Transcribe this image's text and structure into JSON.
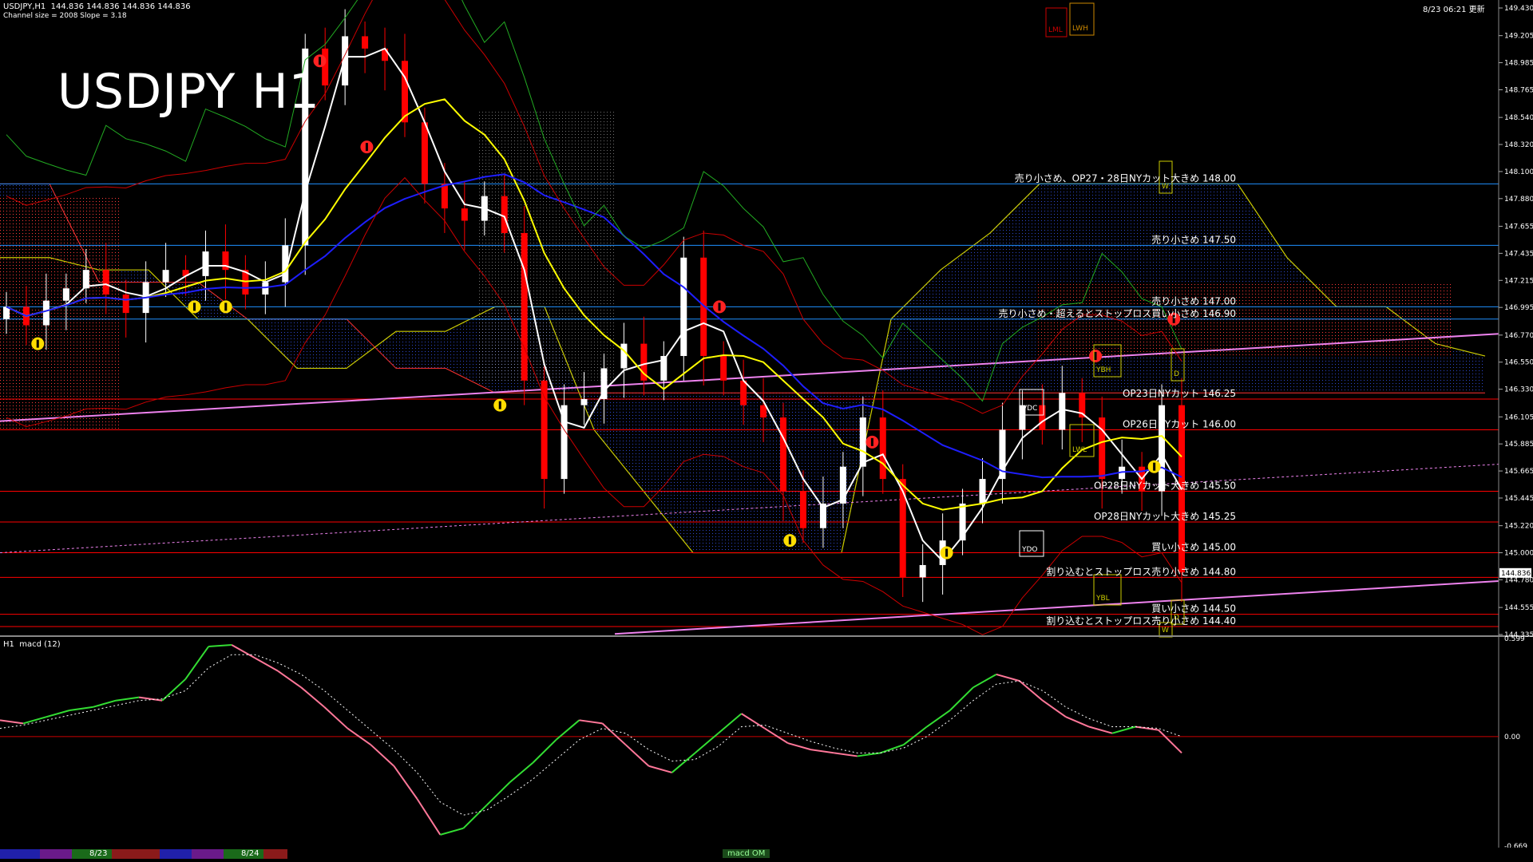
{
  "header": {
    "symbol_line": "USDJPY,H1  144.836 144.836 144.836 144.836",
    "channel_line": "Channel size = 2008 Slope = 3.18",
    "datetime": "8/23 06:21 更新",
    "big_title": "USDJPY H1",
    "macd_label": "H1  macd (12)"
  },
  "bottom": {
    "date1": "8/23",
    "date2": "8/24",
    "tab_label": "macd OM"
  },
  "colors": {
    "bull_candle": "#ffffff",
    "bear_candle": "#ff0000",
    "ma_white": "#ffffff",
    "ma_yellow": "#ffff00",
    "ma_blue": "#1e1eff",
    "level_line": "#ff0000",
    "blue_level": "#1e90ff",
    "channel": "#ee82ee",
    "macd_up": "#33dd33",
    "macd_down": "#ff7799"
  },
  "chart_data": [
    {
      "type": "candlestick",
      "title": "USDJPY H1",
      "y_ticks": [
        "149.430",
        "149.205",
        "148.985",
        "148.765",
        "148.540",
        "148.320",
        "148.100",
        "147.880",
        "147.655",
        "147.435",
        "147.215",
        "146.995",
        "146.770",
        "146.550",
        "146.330",
        "146.105",
        "145.885",
        "145.665",
        "145.445",
        "145.220",
        "145.000",
        "144.780",
        "144.555",
        "144.335"
      ],
      "ylim": [
        144.335,
        149.43
      ],
      "current_price": "144.836",
      "levels": [
        {
          "label": "売り小さめ、OP27・28日NYカット大きめ 148.00",
          "price": 148.0,
          "color": "#1e90ff"
        },
        {
          "label": "売り小さめ 147.50",
          "price": 147.5,
          "color": "#1e90ff"
        },
        {
          "label": "売り小さめ 147.00",
          "price": 147.0,
          "color": "#1e90ff"
        },
        {
          "label": "売り小さめ・超えるとストップロス買い小さめ 146.90",
          "price": 146.9,
          "color": "#1e90ff"
        },
        {
          "label": "OP23日NYカット 146.25",
          "price": 146.25,
          "color": "#ff0000"
        },
        {
          "label": "OP26日NYカット 146.00",
          "price": 146.0,
          "color": "#ff0000"
        },
        {
          "label": "OP28日NYカット大きめ 145.50",
          "price": 145.5,
          "color": "#ff0000"
        },
        {
          "label": "OP28日NYカット大きめ 145.25",
          "price": 145.25,
          "color": "#ff0000"
        },
        {
          "label": "買い小さめ 145.00",
          "price": 145.0,
          "color": "#ff0000"
        },
        {
          "label": "割り込むとストップロス売り小さめ 144.80",
          "price": 144.8,
          "color": "#ff0000"
        },
        {
          "label": "買い小さめ 144.50",
          "price": 144.5,
          "color": "#ff0000"
        },
        {
          "label": "割り込むとストップロス売り小さめ 144.40",
          "price": 144.4,
          "color": "#ff0000"
        }
      ],
      "box_labels": [
        "LML",
        "LWH",
        "VDC",
        "YDO",
        "YBH",
        "YBL",
        "LWL",
        "D",
        "W"
      ],
      "close_path": [
        147.0,
        146.85,
        147.05,
        147.15,
        147.3,
        147.1,
        146.95,
        147.2,
        147.3,
        147.25,
        147.45,
        147.3,
        147.1,
        147.2,
        147.5,
        149.1,
        148.8,
        149.2,
        149.1,
        149.0,
        148.5,
        148.0,
        147.8,
        147.7,
        147.9,
        147.6,
        146.4,
        145.6,
        146.2,
        146.25,
        146.5,
        146.7,
        146.4,
        146.6,
        147.4,
        146.6,
        146.4,
        146.2,
        146.1,
        145.5,
        145.2,
        145.4,
        145.7,
        146.1,
        145.6,
        144.8,
        144.9,
        145.1,
        145.4,
        145.6,
        146.0,
        146.2,
        146.0,
        146.3,
        146.1,
        145.6,
        145.7,
        145.5,
        146.2,
        144.84
      ]
    },
    {
      "type": "line",
      "title": "H1  macd (12)",
      "y_ticks": [
        "0.599",
        "0.00",
        "-0.669"
      ],
      "ylim": [
        -0.669,
        0.599
      ],
      "macd": [
        0.1,
        0.08,
        0.12,
        0.16,
        0.18,
        0.22,
        0.24,
        0.22,
        0.35,
        0.55,
        0.56,
        0.48,
        0.4,
        0.3,
        0.18,
        0.05,
        -0.05,
        -0.18,
        -0.38,
        -0.6,
        -0.56,
        -0.42,
        -0.28,
        -0.16,
        -0.02,
        0.1,
        0.08,
        -0.05,
        -0.18,
        -0.22,
        -0.1,
        0.02,
        0.14,
        0.05,
        -0.04,
        -0.08,
        -0.1,
        -0.12,
        -0.1,
        -0.05,
        0.06,
        0.16,
        0.3,
        0.38,
        0.34,
        0.22,
        0.12,
        0.06,
        0.02,
        0.06,
        0.04,
        -0.1
      ],
      "signal": [
        0.05,
        0.07,
        0.1,
        0.13,
        0.16,
        0.19,
        0.22,
        0.23,
        0.28,
        0.42,
        0.5,
        0.5,
        0.45,
        0.38,
        0.28,
        0.16,
        0.04,
        -0.08,
        -0.22,
        -0.4,
        -0.48,
        -0.45,
        -0.36,
        -0.26,
        -0.14,
        -0.02,
        0.05,
        0.02,
        -0.08,
        -0.15,
        -0.14,
        -0.06,
        0.06,
        0.07,
        0.02,
        -0.03,
        -0.07,
        -0.1,
        -0.1,
        -0.07,
        0.0,
        0.1,
        0.22,
        0.32,
        0.34,
        0.28,
        0.18,
        0.11,
        0.06,
        0.06,
        0.05,
        0.0
      ]
    }
  ]
}
